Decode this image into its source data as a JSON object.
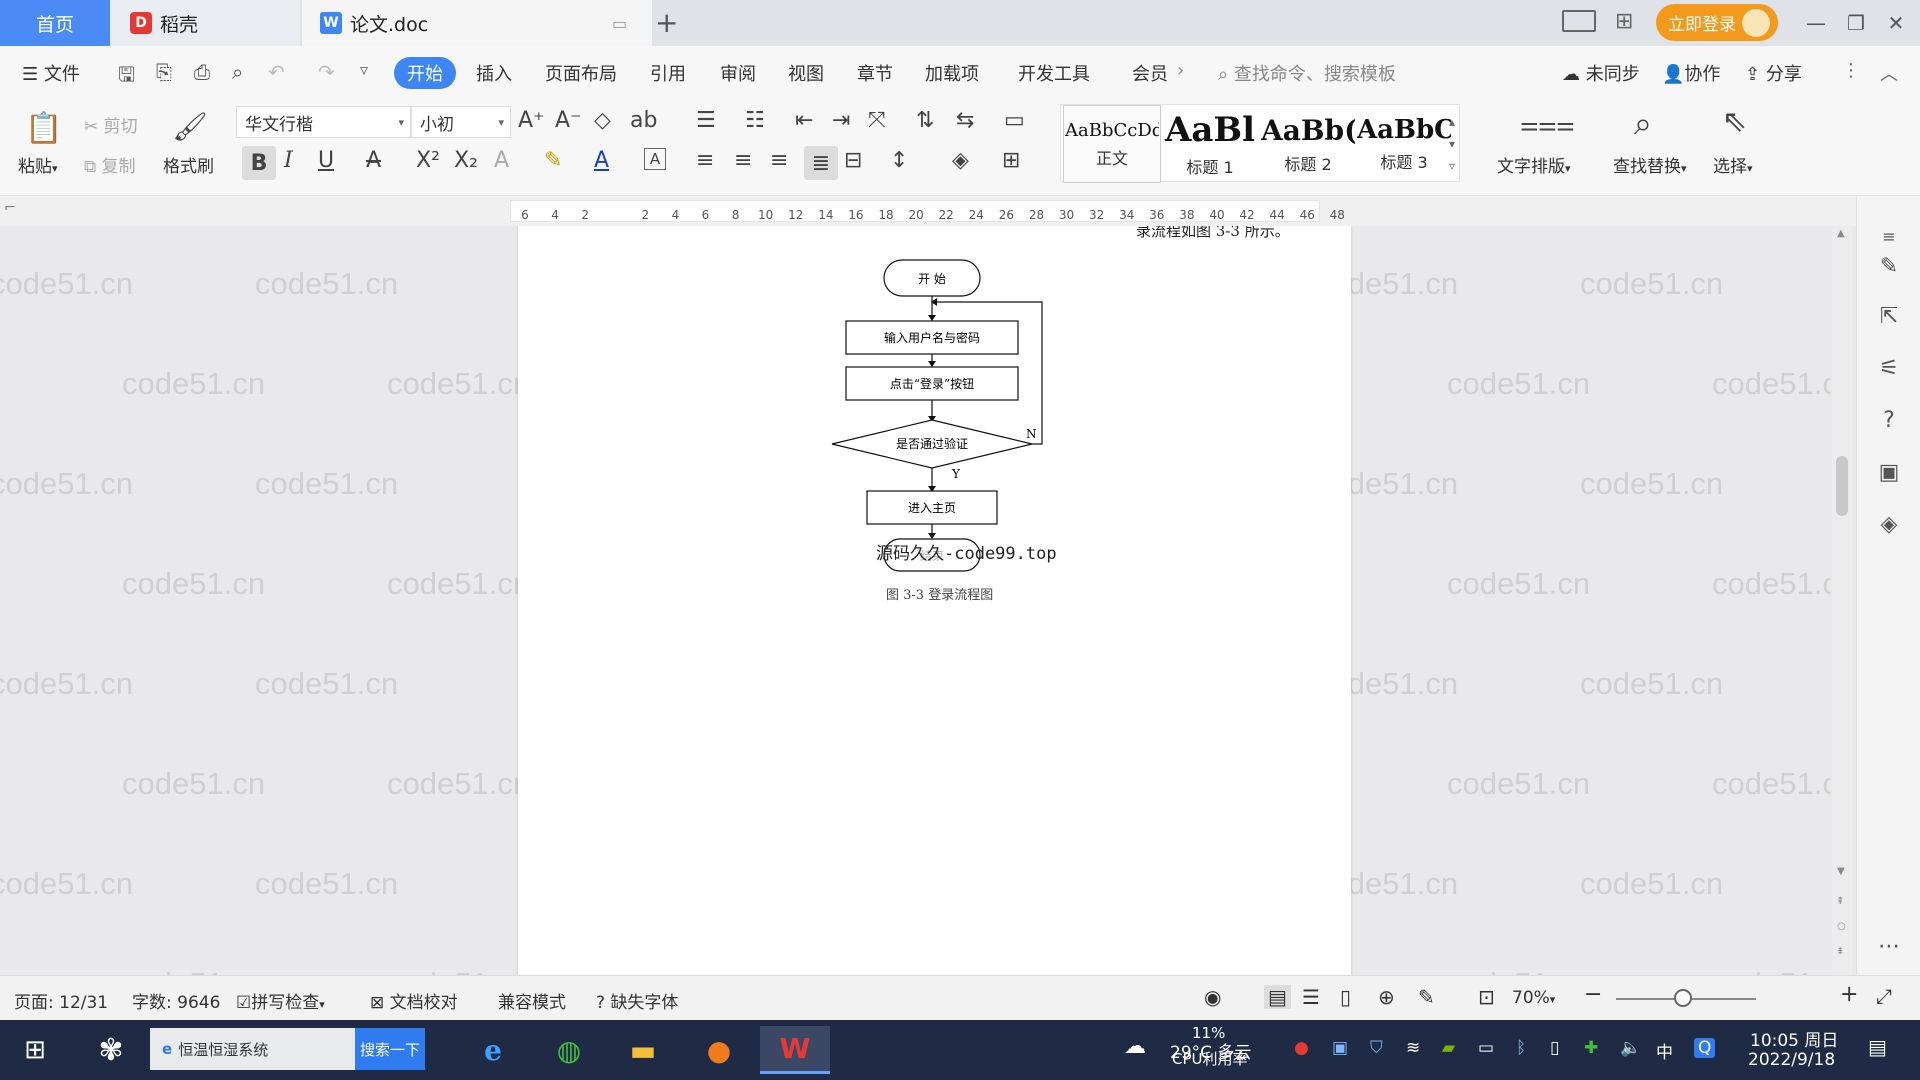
{
  "tabs": {
    "home": "首页",
    "daoke": "稻壳",
    "doc": "论文.doc",
    "login": "立即登录"
  },
  "menubar": {
    "file": "文件",
    "start": "开始",
    "items": [
      "插入",
      "页面布局",
      "引用",
      "审阅",
      "视图",
      "章节",
      "加载项",
      "开发工具",
      "会员"
    ],
    "search_placeholder": "查找命令、搜索模板",
    "sync": "未同步",
    "collab": "协作",
    "share": "分享"
  },
  "ribbon": {
    "paste": "粘贴",
    "cut": "剪切",
    "copy": "复制",
    "format_painter": "格式刷",
    "font_name": "华文行楷",
    "font_size": "小初",
    "styles": [
      {
        "preview": "AaBbCcDd",
        "name": "正文"
      },
      {
        "preview": "AaBl",
        "name": "标题 1"
      },
      {
        "preview": "AaBb(",
        "name": "标题 2"
      },
      {
        "preview": "AaBbC",
        "name": "标题 3"
      }
    ],
    "text_layout": "文字排版",
    "find_replace": "查找替换",
    "select": "选择"
  },
  "ruler_ticks": [
    "6",
    "4",
    "2",
    "",
    "2",
    "4",
    "6",
    "8",
    "10",
    "12",
    "14",
    "16",
    "18",
    "20",
    "22",
    "24",
    "26",
    "28",
    "30",
    "32",
    "34",
    "36",
    "38",
    "40",
    "42",
    "44",
    "46",
    "48"
  ],
  "document": {
    "intro_text": "录流程如图 3-3 所示。",
    "flowchart": {
      "start": "开 始",
      "step1": "输入用户名与密码",
      "step2": "点击“登录”按钮",
      "decision": "是否通过验证",
      "no_label": "N",
      "yes_label": "Y",
      "step3": "进入主页",
      "end": "结束"
    },
    "overlay_text": "源码久久-code99.top",
    "caption": "图 3-3 登录流程图",
    "watermark": "code51.cn"
  },
  "statusbar": {
    "page": "页面: 12/31",
    "words": "字数: 9646",
    "spell": "拼写检查",
    "proof": "文档校对",
    "compat": "兼容模式",
    "missing_font": "缺失字体",
    "zoom": "70%"
  },
  "taskbar": {
    "search_text": "恒温恒湿系统",
    "search_btn": "搜索一下",
    "weather": "29°C 多云",
    "cpu_pct": "11%",
    "cpu_label": "CPU利用率",
    "ime": "中",
    "time": "10:05 周日",
    "date": "2022/9/18"
  },
  "colors": {
    "accent": "#3d86f4",
    "login": "#f39a1c",
    "taskbar": "#1f2a44"
  }
}
